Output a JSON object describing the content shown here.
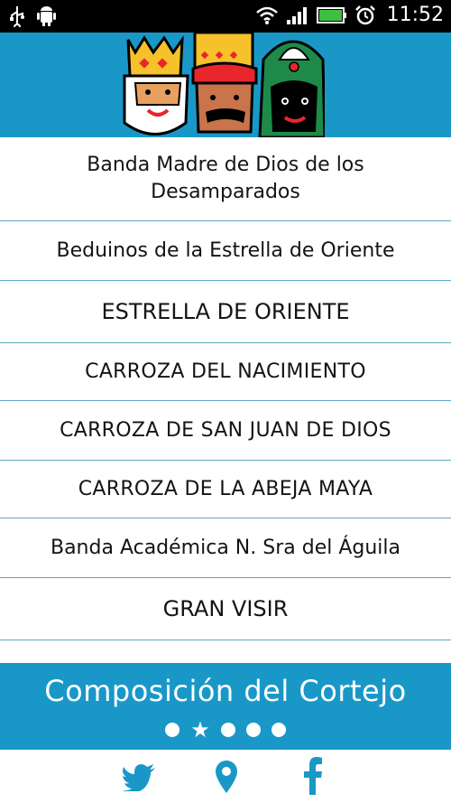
{
  "status_bar": {
    "time": "11:52",
    "icons": [
      "usb-icon",
      "android-debug-icon",
      "wifi-icon",
      "signal-icon",
      "battery-icon",
      "alarm-icon"
    ]
  },
  "list": {
    "items": [
      {
        "label": "Banda Madre de Dios de los Desamparados",
        "lines": [
          "Banda Madre de Dios de los",
          "Desamparados"
        ]
      },
      {
        "label": "Beduinos de la Estrella de Oriente"
      },
      {
        "label": "ESTRELLA DE ORIENTE"
      },
      {
        "label": "CARROZA DEL NACIMIENTO"
      },
      {
        "label": "CARROZA DE SAN JUAN DE DIOS"
      },
      {
        "label": "CARROZA DE LA ABEJA MAYA"
      },
      {
        "label": "Banda Académica N. Sra del Águila"
      },
      {
        "label": "GRAN VISIR"
      }
    ]
  },
  "footer": {
    "title": "Composición del Cortejo",
    "pager": {
      "pages": 5,
      "current": 2
    }
  },
  "bottom_bar": {
    "icons": [
      "twitter-icon",
      "location-pin-icon",
      "facebook-icon"
    ]
  },
  "colors": {
    "accent": "#1998c8",
    "divider": "#5fa6c9",
    "text": "#141414"
  }
}
